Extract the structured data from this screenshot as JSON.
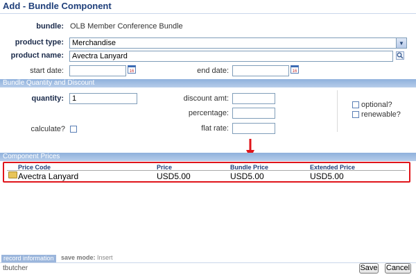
{
  "page": {
    "title": "Add - Bundle Component"
  },
  "header": {
    "bundle_label": "bundle:",
    "bundle_value": "OLB Member Conference Bundle",
    "product_type_label": "product type:",
    "product_type_value": "Merchandise",
    "product_name_label": "product name:",
    "product_name_value": "Avectra Lanyard",
    "start_date_label": "start date:",
    "start_date_value": "",
    "end_date_label": "end date:",
    "end_date_value": ""
  },
  "quantity_section": {
    "title": "Bundle Quantity and Discount",
    "quantity_label": "quantity:",
    "quantity_value": "1",
    "calculate_label": "calculate?",
    "discount_amt_label": "discount amt:",
    "discount_amt_value": "",
    "percentage_label": "percentage:",
    "percentage_value": "",
    "flat_rate_label": "flat rate:",
    "flat_rate_value": "",
    "optional_label": "optional?",
    "renewable_label": "renewable?"
  },
  "component_prices": {
    "title": "Component Prices",
    "columns": [
      "Price Code",
      "Price",
      "Bundle Price",
      "Extended Price"
    ],
    "rows": [
      {
        "price_code": "Avectra Lanyard",
        "price": "USD5.00",
        "bundle_price": "USD5.00",
        "extended_price": "USD5.00"
      }
    ]
  },
  "footer": {
    "record_information": "record information",
    "save_mode_label": "save mode:",
    "save_mode_value": "Insert",
    "user": "tbutcher",
    "save_label": "Save",
    "cancel_label": "Cancel"
  },
  "colors": {
    "accent": "#1f3f7a",
    "section_bar": "#8fb1dc",
    "highlight": "#e0141a"
  },
  "icons": [
    "calendar-icon",
    "search-icon",
    "folder-icon",
    "dropdown-arrow-icon",
    "red-arrow-icon"
  ]
}
